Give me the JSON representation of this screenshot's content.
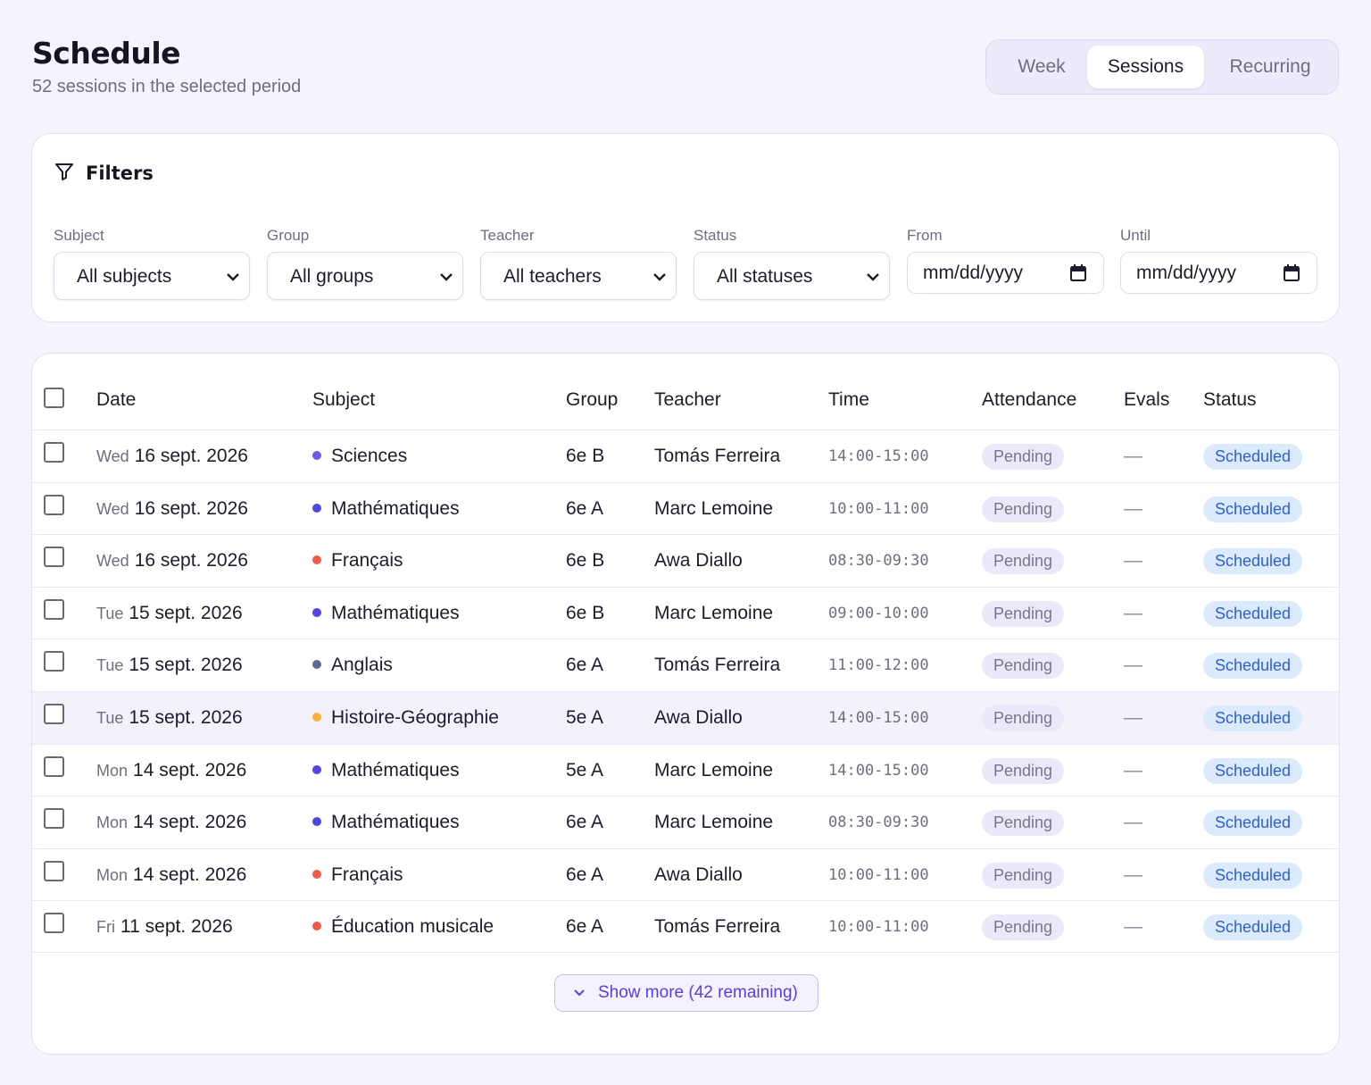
{
  "header": {
    "title": "Schedule",
    "subtitle": "52 sessions in the selected period"
  },
  "view_tabs": [
    {
      "label": "Week",
      "active": false
    },
    {
      "label": "Sessions",
      "active": true
    },
    {
      "label": "Recurring",
      "active": false
    }
  ],
  "filters": {
    "title": "Filters",
    "subject": {
      "label": "Subject",
      "value": "All subjects"
    },
    "group": {
      "label": "Group",
      "value": "All groups"
    },
    "teacher": {
      "label": "Teacher",
      "value": "All teachers"
    },
    "status": {
      "label": "Status",
      "value": "All statuses"
    },
    "from": {
      "label": "From",
      "placeholder": "mm/dd/yyyy"
    },
    "until": {
      "label": "Until",
      "placeholder": "mm/dd/yyyy"
    }
  },
  "table": {
    "columns": [
      "Date",
      "Subject",
      "Group",
      "Teacher",
      "Time",
      "Attendance",
      "Evals",
      "Status"
    ],
    "rows": [
      {
        "weekday": "Wed",
        "date": "16 sept. 2026",
        "subject": "Sciences",
        "subject_color": "#6e5ce6",
        "group": "6e B",
        "teacher": "Tomás Ferreira",
        "time": "14:00-15:00",
        "attendance": "Pending",
        "evals": "—",
        "status": "Scheduled"
      },
      {
        "weekday": "Wed",
        "date": "16 sept. 2026",
        "subject": "Mathématiques",
        "subject_color": "#4f46e5",
        "group": "6e A",
        "teacher": "Marc Lemoine",
        "time": "10:00-11:00",
        "attendance": "Pending",
        "evals": "—",
        "status": "Scheduled"
      },
      {
        "weekday": "Wed",
        "date": "16 sept. 2026",
        "subject": "Français",
        "subject_color": "#ef5a45",
        "group": "6e B",
        "teacher": "Awa Diallo",
        "time": "08:30-09:30",
        "attendance": "Pending",
        "evals": "—",
        "status": "Scheduled"
      },
      {
        "weekday": "Tue",
        "date": "15 sept. 2026",
        "subject": "Mathématiques",
        "subject_color": "#4f46e5",
        "group": "6e B",
        "teacher": "Marc Lemoine",
        "time": "09:00-10:00",
        "attendance": "Pending",
        "evals": "—",
        "status": "Scheduled"
      },
      {
        "weekday": "Tue",
        "date": "15 sept. 2026",
        "subject": "Anglais",
        "subject_color": "#5b6b9a",
        "group": "6e A",
        "teacher": "Tomás Ferreira",
        "time": "11:00-12:00",
        "attendance": "Pending",
        "evals": "—",
        "status": "Scheduled"
      },
      {
        "weekday": "Tue",
        "date": "15 sept. 2026",
        "subject": "Histoire-Géographie",
        "subject_color": "#f5b23a",
        "group": "5e A",
        "teacher": "Awa Diallo",
        "time": "14:00-15:00",
        "attendance": "Pending",
        "evals": "—",
        "status": "Scheduled"
      },
      {
        "weekday": "Mon",
        "date": "14 sept. 2026",
        "subject": "Mathématiques",
        "subject_color": "#4f46e5",
        "group": "5e A",
        "teacher": "Marc Lemoine",
        "time": "14:00-15:00",
        "attendance": "Pending",
        "evals": "—",
        "status": "Scheduled"
      },
      {
        "weekday": "Mon",
        "date": "14 sept. 2026",
        "subject": "Mathématiques",
        "subject_color": "#4f46e5",
        "group": "6e A",
        "teacher": "Marc Lemoine",
        "time": "08:30-09:30",
        "attendance": "Pending",
        "evals": "—",
        "status": "Scheduled"
      },
      {
        "weekday": "Mon",
        "date": "14 sept. 2026",
        "subject": "Français",
        "subject_color": "#ef5a45",
        "group": "6e A",
        "teacher": "Awa Diallo",
        "time": "10:00-11:00",
        "attendance": "Pending",
        "evals": "—",
        "status": "Scheduled"
      },
      {
        "weekday": "Fri",
        "date": "11 sept. 2026",
        "subject": "Éducation musicale",
        "subject_color": "#ef5a45",
        "group": "6e A",
        "teacher": "Tomás Ferreira",
        "time": "10:00-11:00",
        "attendance": "Pending",
        "evals": "—",
        "status": "Scheduled"
      }
    ]
  },
  "show_more_label": "Show more (42 remaining)"
}
